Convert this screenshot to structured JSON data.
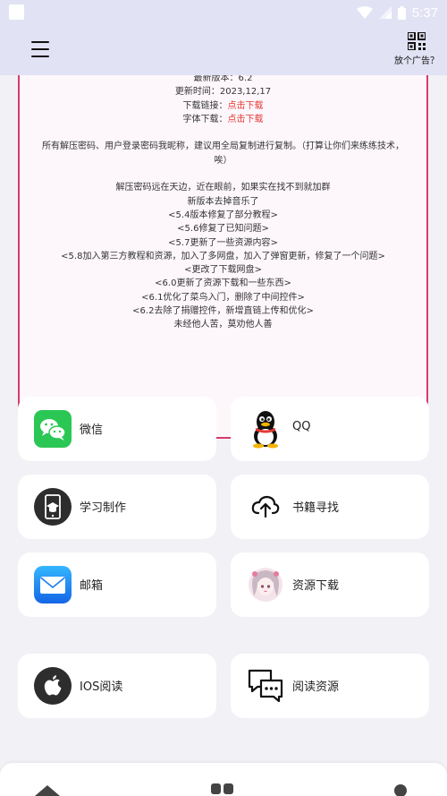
{
  "status_bar": {
    "time": "5:37"
  },
  "app_bar": {
    "ad_label": "放个广告？"
  },
  "notice": {
    "lines": [
      "最新版本：6.2",
      "更新时间：2023,12,17"
    ],
    "download_label": "下载链接：",
    "download_link": "点击下载",
    "font_label": "字体下载：",
    "font_link": "点击下载",
    "password_note": "所有解压密码、用户登录密码我昵称，建议用全局复制进行复制。（打算让你们来练练技术，唉）",
    "changelog": [
      "解压密码远在天边，近在眼前，如果实在找不到就加群",
      "新版本去掉音乐了",
      "<5.4版本修复了部分教程>",
      "<5.6修复了已知问题>",
      "<5.7更新了一些资源内容>",
      "<5.8加入第三方教程和资源，加入了多网盘，加入了弹窗更新，修复了一个问题>",
      "<更改了下载网盘>",
      "<6.0更新了资源下载和一些东西>",
      "<6.1优化了菜鸟入门，删除了中间控件>",
      "<6.2去除了捐赠控件，新增直链上传和优化>",
      "未经他人苦，莫劝他人善"
    ]
  },
  "tiles": {
    "wechat": "微信",
    "qq": "QQ",
    "study": "学习制作",
    "books": "书籍寻找",
    "mail": "邮箱",
    "resources": "资源下载",
    "ios": "IOS阅读",
    "reading": "阅读资源"
  },
  "colors": {
    "accent": "#d63a6e",
    "app_bar": "#e2e2f5",
    "link": "#e53935",
    "wechat_green": "#2bc754"
  },
  "icons": [
    "menu-icon",
    "qr-code-icon",
    "wechat-icon",
    "qq-penguin-icon",
    "study-phone-icon",
    "cloud-upload-icon",
    "mail-icon",
    "anime-avatar-icon",
    "apple-icon",
    "chat-bubbles-icon",
    "home-icon",
    "grid-icon",
    "profile-icon"
  ]
}
